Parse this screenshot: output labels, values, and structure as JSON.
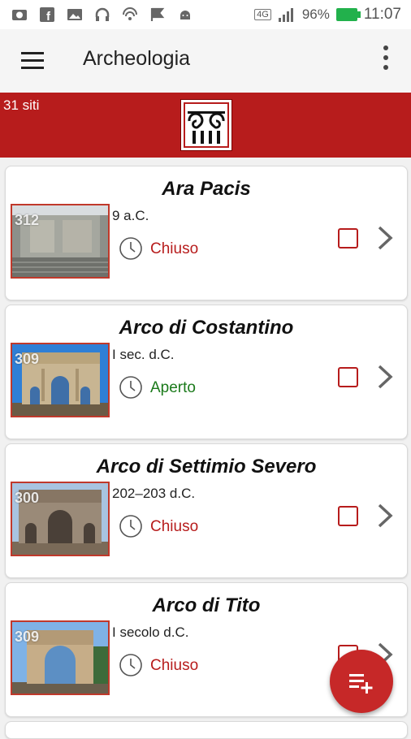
{
  "statusbar": {
    "network": "4G",
    "battery": "96%",
    "time": "11:07"
  },
  "appbar": {
    "title": "Archeologia"
  },
  "banner": {
    "count": "31 siti"
  },
  "cards": [
    {
      "title": "Ara Pacis",
      "thumb_number": "312",
      "date": "9 a.C.",
      "status": "Chiuso",
      "status_type": "closed"
    },
    {
      "title": "Arco di Costantino",
      "thumb_number": "309",
      "date": "I sec. d.C.",
      "status": "Aperto",
      "status_type": "open"
    },
    {
      "title": "Arco di Settimio Severo",
      "thumb_number": "300",
      "date": "202–203 d.C.",
      "status": "Chiuso",
      "status_type": "closed"
    },
    {
      "title": "Arco di Tito",
      "thumb_number": "309",
      "date": "I secolo d.C.",
      "status": "Chiuso",
      "status_type": "closed"
    }
  ],
  "colors": {
    "accent": "#b71c1c",
    "open": "#1b7a1b",
    "closed": "#b71c1c"
  }
}
